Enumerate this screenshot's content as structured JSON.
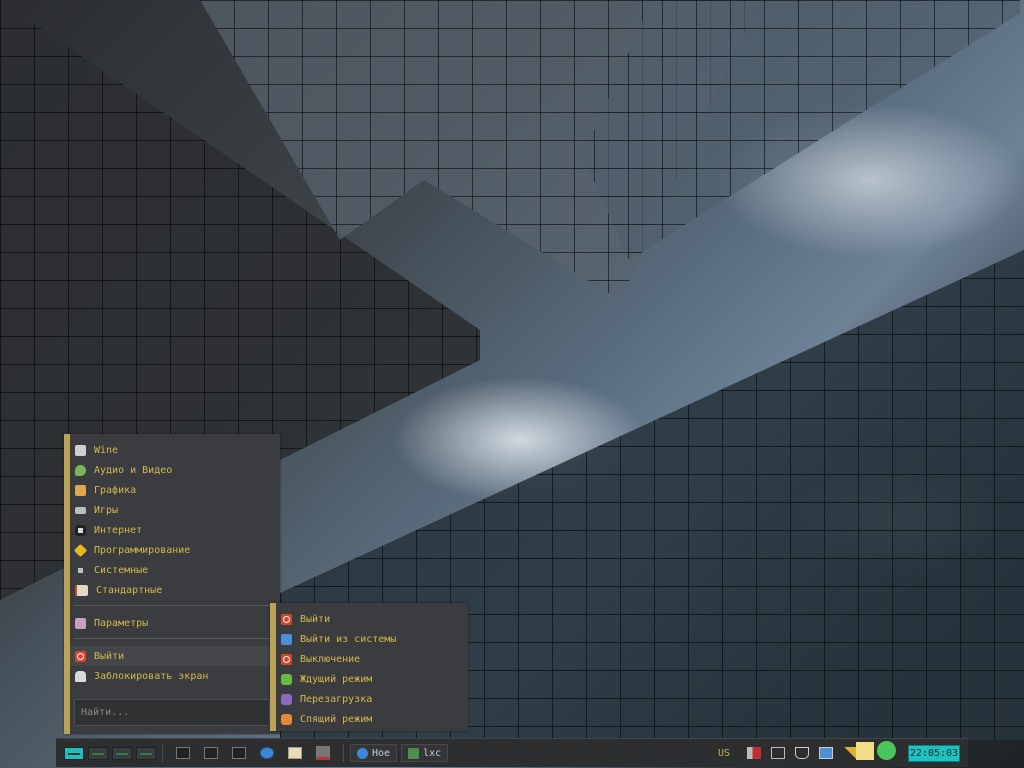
{
  "menu": {
    "items": [
      {
        "label": "Wine",
        "icon": "wine-icon",
        "color": "#cfcfcf"
      },
      {
        "label": "Аудио и Видео",
        "icon": "music-note-icon",
        "color": "#7ab55c"
      },
      {
        "label": "Графика",
        "icon": "graphics-icon",
        "color": "#e0a84b"
      },
      {
        "label": "Игры",
        "icon": "gamepad-icon",
        "color": "#bdbdbd"
      },
      {
        "label": "Интернет",
        "icon": "internet-icon",
        "color": "#d8d8d8"
      },
      {
        "label": "Программирование",
        "icon": "programming-icon",
        "color": "#e6b820"
      },
      {
        "label": "Системные",
        "icon": "gear-icon",
        "color": "#bfbfbf"
      },
      {
        "label": "Стандартные",
        "icon": "accessories-icon",
        "color": "#e3d9c6"
      }
    ],
    "settings": {
      "label": "Параметры",
      "icon": "settings-icon",
      "color": "#c9a0c2"
    },
    "logout": {
      "label": "Выйти",
      "icon": "power-icon",
      "color": "#d9452b"
    },
    "lock": {
      "label": "Заблокировать экран",
      "icon": "lock-icon",
      "color": "#d9d9d9"
    },
    "search": {
      "placeholder": "Найти..."
    }
  },
  "logout_menu": {
    "items": [
      {
        "label": "Выйти",
        "icon": "power-icon",
        "color": "#d9452b"
      },
      {
        "label": "Выйти из системы",
        "icon": "logout-arrow-icon",
        "color": "#4c8fd6"
      },
      {
        "label": "Выключение",
        "icon": "shutdown-icon",
        "color": "#d9452b"
      },
      {
        "label": "Ждущий режим",
        "icon": "suspend-icon",
        "color": "#66bb44"
      },
      {
        "label": "Перезагрузка",
        "icon": "reboot-icon",
        "color": "#8e6bbf"
      },
      {
        "label": "Спящий режим",
        "icon": "hibernate-icon",
        "color": "#e08a3a"
      }
    ]
  },
  "taskbar": {
    "tasks": [
      {
        "label": "Hoe",
        "icon": "browser-globe-icon",
        "color": "#3d87d8"
      },
      {
        "label": "lxc",
        "icon": "terminal-icon",
        "color": "#4a8f4a"
      }
    ],
    "keyboard_layout": "US",
    "clock": "22:05:03"
  },
  "colors": {
    "menu_bg": "#3a3c3f",
    "menu_text": "#d5b84c",
    "accent_bar": "#b9a25a",
    "clock_bg": "#1ec2c2"
  }
}
